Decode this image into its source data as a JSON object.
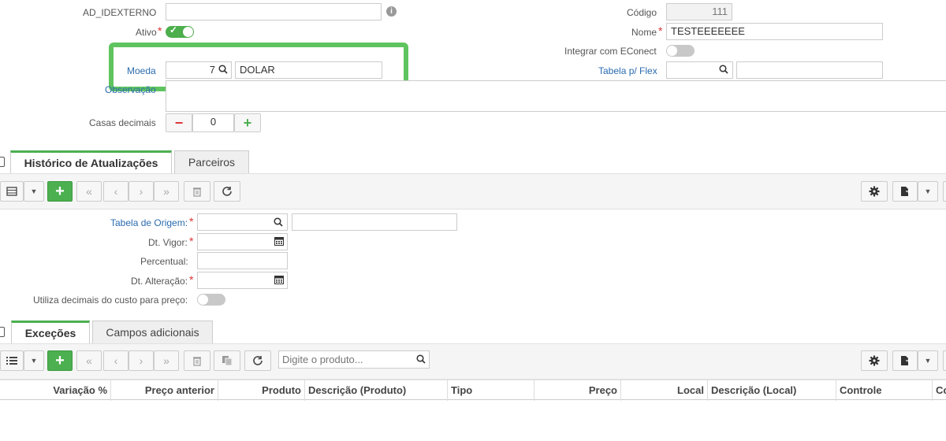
{
  "form": {
    "ad_idexterno_label": "AD_IDEXTERNO",
    "ativo_label": "Ativo",
    "moeda_label": "Moeda",
    "moeda_code": "7",
    "moeda_desc": "DOLAR",
    "observacao_label": "Observação",
    "casas_label": "Casas decimais",
    "casas_value": "0",
    "codigo_label": "Código",
    "codigo_value": "111",
    "nome_label": "Nome",
    "nome_value": "TESTEEEEEEE",
    "econect_label": "Integrar com EConect",
    "tabela_flex_label": "Tabela p/ Flex"
  },
  "tabs1": [
    "Histórico de Atualizações",
    "Parceiros"
  ],
  "hist_form": {
    "tabela_origem_label": "Tabela de Origem:",
    "dt_vigor_label": "Dt. Vigor:",
    "percentual_label": "Percentual:",
    "dt_alteracao_label": "Dt. Alteração:",
    "utiliza_label": "Utiliza decimais do custo para preço:"
  },
  "tabs2": [
    "Exceções",
    "Campos adicionais"
  ],
  "search": {
    "placeholder": "Digite o produto..."
  },
  "grid_columns": [
    "Variação %",
    "Preço anterior",
    "Produto",
    "Descrição (Produto)",
    "Tipo",
    "Preço",
    "Local",
    "Descrição (Local)",
    "Controle",
    "Co"
  ],
  "colors": {
    "accent": "#4caf50",
    "highlight": "#5fc45f",
    "link": "#2b6cb0",
    "required": "#dd3333"
  }
}
